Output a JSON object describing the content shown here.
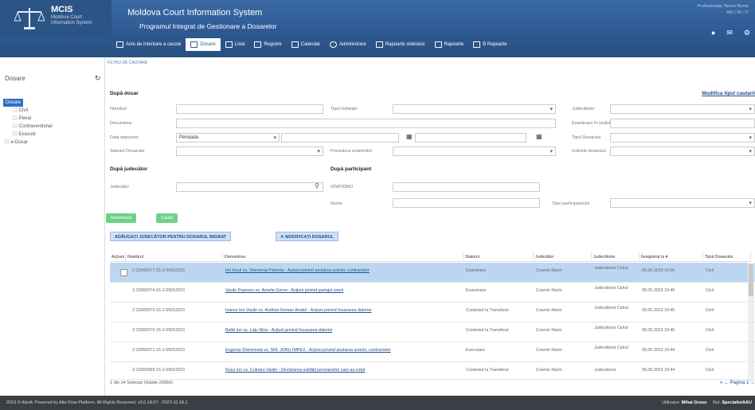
{
  "header": {
    "logo_title": "MCIS",
    "logo_subtitle": "Moldova Court Information System",
    "app_title": "Moldova Court Information System",
    "app_subtitle": "Programul Integrat de Gestionare a Dosarelor",
    "top_right_line1": "Profesionala, Nume Nume",
    "top_right_line2": "MD | IN | IT",
    "icons": [
      "chat-icon",
      "mail-icon",
      "gear-icon"
    ]
  },
  "menu": [
    {
      "label": "Acte de intentare a cauzei",
      "icon": "document-edit-icon",
      "active": false
    },
    {
      "label": "Dosare",
      "icon": "folder-icon",
      "active": true
    },
    {
      "label": "Lista",
      "icon": "list-icon",
      "active": false
    },
    {
      "label": "Registre",
      "icon": "book-icon",
      "active": false
    },
    {
      "label": "Calendar",
      "icon": "calendar-icon",
      "active": false
    },
    {
      "label": "Administrare",
      "icon": "user-icon",
      "active": false
    },
    {
      "label": "Rapoarte statistice",
      "icon": "chart-icon",
      "active": false
    },
    {
      "label": "Rapoarte",
      "icon": "report-icon",
      "active": false
    },
    {
      "label": "B Rapoarte",
      "icon": "bar-chart-icon",
      "active": false
    }
  ],
  "sidebar": {
    "title": "Dosare",
    "root": "Dosare",
    "items": [
      "Civil",
      "Penal",
      "Contraventional",
      "Executii"
    ],
    "extra": "e-Dosar"
  },
  "filters": {
    "breadcrumb": "FILTRU DE CAUTARE",
    "section_dosar": "După dosar",
    "modifica": "Modifica tipul cautarii",
    "numar_label": "Numărul",
    "tipul_instantei_label": "Tipul instanței",
    "judecatorie_label": "Judecătorie",
    "denumirea_label": "Denumirea",
    "examinare_label": "Examinare în sediul",
    "data_label": "Data depunerii",
    "data_value": "Perioada",
    "tipul_dosarului_label": "Tipul Dosarului",
    "statutul_label": "Statutul Dosarului",
    "procedura_label": "Procedura examinării",
    "indicele_label": "Indicele dosarului",
    "section_judecator": "După judecător",
    "judecator_label": "Judecător",
    "section_participant": "După participant",
    "idnp_label": "IDNP/IDNO",
    "nume_label": "Nume",
    "tipul_participantului_label": "Tipul participantului",
    "btn_search": "Resetează",
    "btn_find": "Caută"
  },
  "actions": {
    "add_judge": "ADĂUGAȚI JUDECĂTOR PENTRU DOSARUL MIGRAT",
    "modify": "MODIFICAȚI DOSARUL"
  },
  "table": {
    "headers": [
      "Acțiuni",
      "Numărul",
      "Denumirea",
      "Statutul",
      "Judecător",
      "Judecătorie",
      "Înregistrat la ▾",
      "Tipul Dosarului"
    ],
    "rows": [
      {
        "numar": "2-23000077-15-2-05052023",
        "denumirea": "Ion Ionul vs. Sheremia Pimenta - Acțiuni privind anularea actelor, contractelor",
        "statut": "Examinare",
        "judecator": "Cosmin Marin",
        "judecatorie": "Judecătoria Cahul",
        "data": "05.05.2023 10:56",
        "tip": "Civil"
      },
      {
        "numar": "2-23000074-15-2-05052023",
        "denumirea": "Vasile Popescu vs. Amelia Gorne - Acțiuni privind partajul averii",
        "statut": "Examinare",
        "judecator": "Cosmin Marin",
        "judecatorie": "Judecătoria Cahul",
        "data": "05.05.2023 10:46",
        "tip": "Civil"
      },
      {
        "numar": "2-23000073-15-2-05052023",
        "denumirea": "Ivanov Ion Vasile vs. Andrian Roman Anatol - Acțiuni privind încasarea datoriei",
        "statut": "Contestat la Transferat",
        "judecator": "Cosmin Marin",
        "judecatorie": "Judecătoria Cahul",
        "data": "05.05.2023 10:45",
        "tip": "Civil"
      },
      {
        "numar": "2-23000070-15-2-05052023",
        "denumirea": "Baltă Ion vs. Lațu Nina - Acțiuni privind încasarea datoriei",
        "statut": "Contestat la Transferat",
        "judecator": "Cosmin Marin",
        "judecatorie": "Judecătoria Cahul",
        "data": "05.05.2023 10:45",
        "tip": "Civil"
      },
      {
        "numar": "2-23000071-15-2-05052023",
        "denumirea": "Eugenia Sheremeta vs. SRL JORU IMPEX - Acțiuni privind anularea actelor, contractelor",
        "statut": "Executare",
        "judecator": "Cosmin Marin",
        "judecatorie": "Judecătoria Cahul",
        "data": "05.05.2023 10:44",
        "tip": "Civil"
      },
      {
        "numar": "2-23000069-15-2-05052023",
        "denumirea": "Nucu Ion vs. Cotnaru Vasile - Declararea nulității persoanelor care au votat",
        "statut": "Contestat la Transferat",
        "judecator": "Cosmin Marin",
        "judecatorie": "Judecătoria",
        "data": "05.05.2023 10:44",
        "tip": "Civil"
      }
    ],
    "footer": "1 din 14 Selectat (Găsite 20050)",
    "pager": "« ← Pagina 1 →"
  },
  "statusbar": {
    "left": "2019 © Alsoft. Powered by Alto Flow Platform. All Rights Reserved. v3.0.18.07 - 2023.10.18.1",
    "user_label": "Utilizator:",
    "user": "Mihai Grosu",
    "role_label": "Rol:",
    "role": "SpecialistAAU"
  }
}
